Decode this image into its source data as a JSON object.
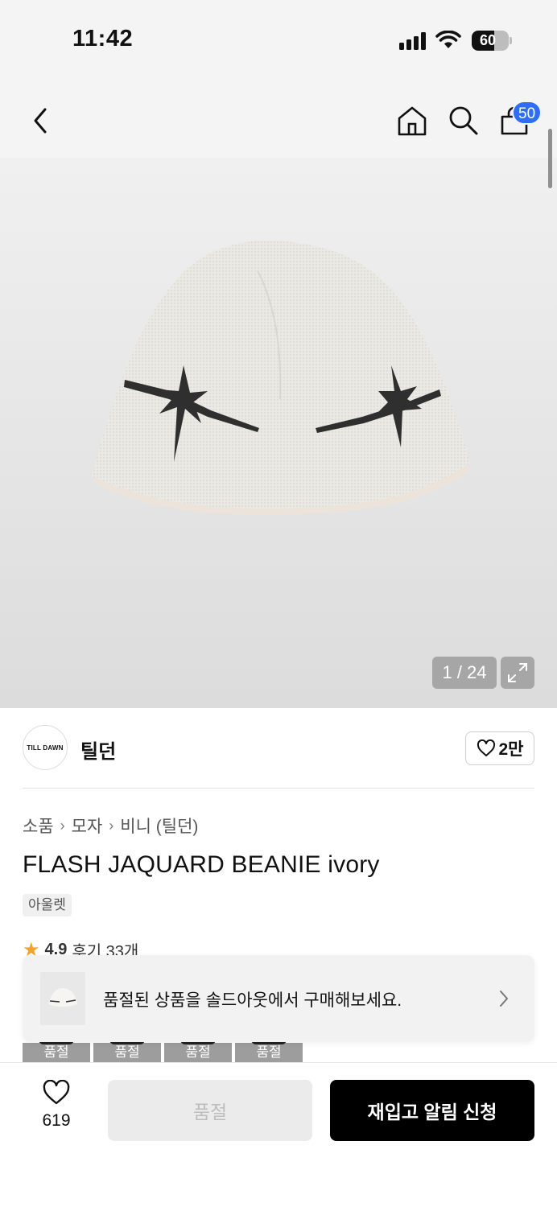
{
  "status_bar": {
    "time": "11:42",
    "battery": "60",
    "battery_level": 0.6
  },
  "nav": {
    "cart_count": "50"
  },
  "gallery": {
    "counter": "1 / 24"
  },
  "brand": {
    "logo_text": "TILL DAWN",
    "name": "틸던",
    "likes": "2만"
  },
  "breadcrumb": [
    "소품",
    "모자",
    "비니 (틸던)"
  ],
  "product": {
    "title": "FLASH JAQUARD BEANIE ivory",
    "tag": "아울렛"
  },
  "rating": {
    "score": "4.9",
    "reviews": "후기 33개"
  },
  "banner": {
    "text": "품절된 상품을 솔드아웃에서 구매해보세요."
  },
  "options": [
    "품절",
    "품절",
    "품절",
    "품절"
  ],
  "bottom": {
    "wish_count": "619",
    "soldout_label": "품절",
    "restock_label": "재입고 알림 신청"
  },
  "colors": {
    "badge": "#2f6ef2",
    "cta": "#000000",
    "star": "#f3a32b"
  }
}
